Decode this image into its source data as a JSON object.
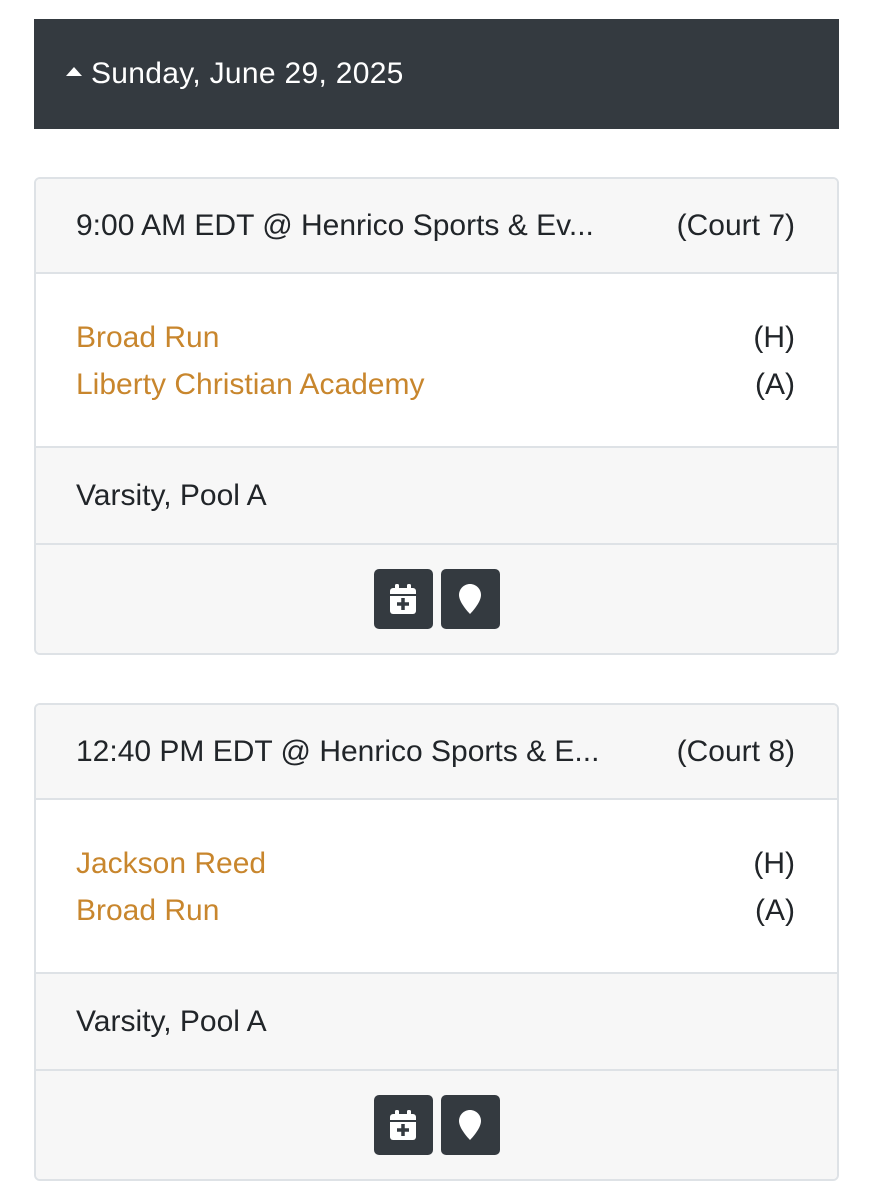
{
  "day": {
    "label": "Sunday, June 29, 2025"
  },
  "games": [
    {
      "time_location": "9:00 AM EDT @ Henrico Sports & Ev...",
      "court": "(Court 7)",
      "home_team": "Broad Run",
      "home_marker": "(H)",
      "away_team": "Liberty Christian Academy",
      "away_marker": "(A)",
      "division": "Varsity, Pool A",
      "actions": [
        "calendar-plus-icon",
        "map-marker-icon"
      ]
    },
    {
      "time_location": "12:40 PM EDT @ Henrico Sports & E...",
      "court": "(Court 8)",
      "home_team": "Jackson Reed",
      "home_marker": "(H)",
      "away_team": "Broad Run",
      "away_marker": "(A)",
      "division": "Varsity, Pool A",
      "actions": [
        "calendar-plus-icon",
        "map-marker-icon"
      ]
    }
  ],
  "colors": {
    "header_bg": "#343a40",
    "team_link": "#c8862d",
    "card_bg": "#f7f7f7",
    "border": "#dee2e6"
  }
}
